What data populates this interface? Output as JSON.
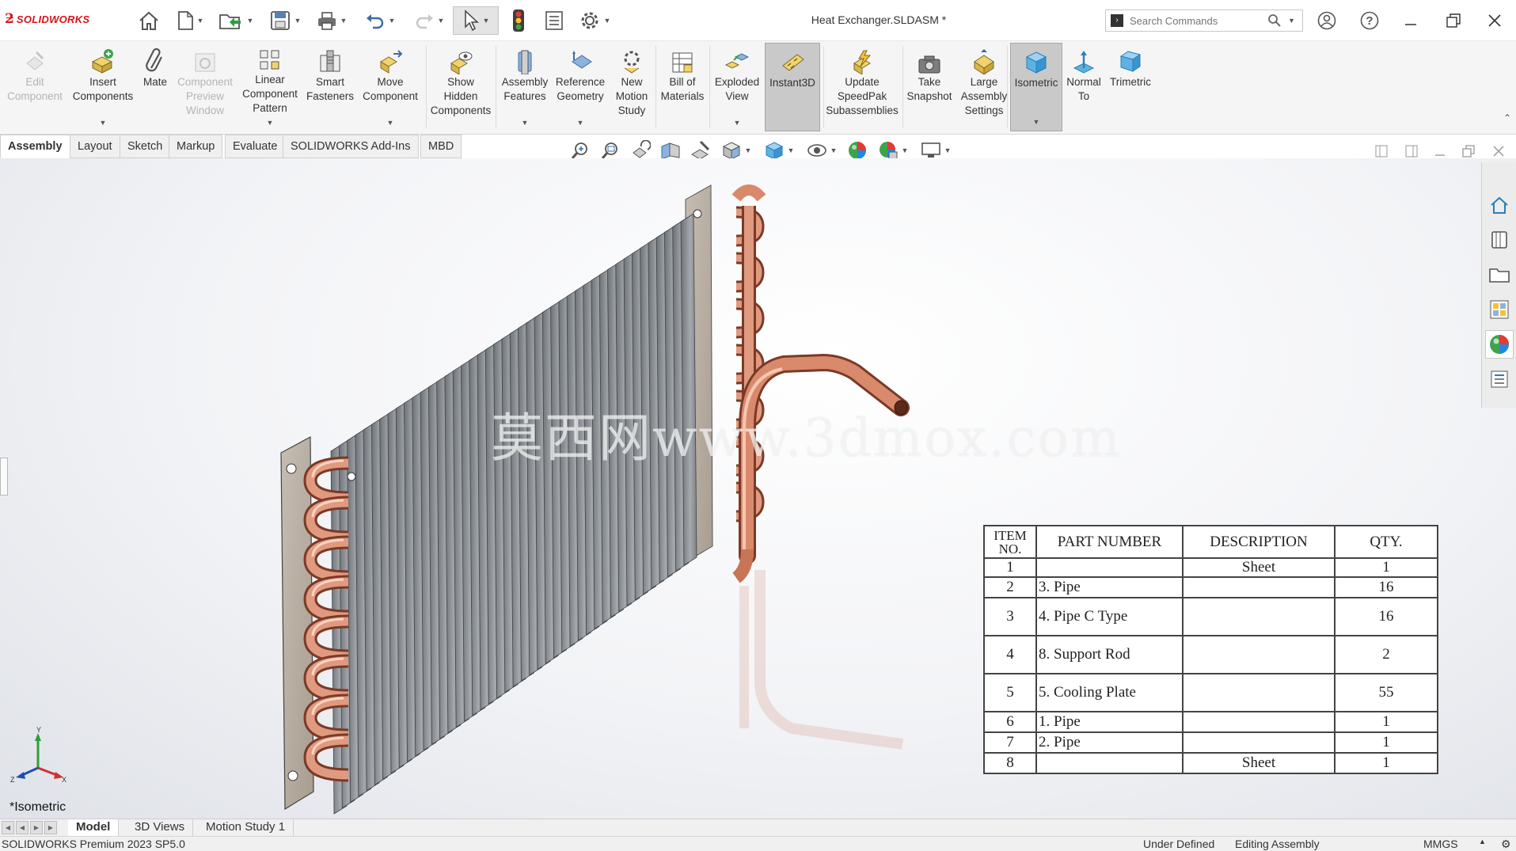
{
  "app": {
    "brand": "SOLIDWORKS",
    "document_title": "Heat Exchanger.SLDASM *"
  },
  "quick_access": [
    {
      "name": "home",
      "icon": "home-icon"
    },
    {
      "name": "new-document",
      "icon": "new-document-icon"
    },
    {
      "name": "open",
      "icon": "open-folder-icon"
    },
    {
      "name": "save",
      "icon": "save-icon"
    },
    {
      "name": "print",
      "icon": "print-icon"
    },
    {
      "name": "undo",
      "icon": "undo-icon"
    },
    {
      "name": "redo",
      "icon": "redo-icon"
    },
    {
      "name": "select",
      "icon": "cursor-icon"
    },
    {
      "name": "rebuild",
      "icon": "traffic-light-icon"
    },
    {
      "name": "file-properties",
      "icon": "file-properties-icon"
    },
    {
      "name": "options",
      "icon": "gear-icon"
    }
  ],
  "search": {
    "placeholder": "Search Commands",
    "value": ""
  },
  "ribbon": {
    "edit_component": "Edit\nComponent",
    "insert_components": "Insert\nComponents",
    "mate": "Mate",
    "component_preview": "Component\nPreview\nWindow",
    "linear_pattern": "Linear\nComponent\nPattern",
    "smart_fasteners": "Smart\nFasteners",
    "move_component": "Move\nComponent",
    "show_hidden": "Show\nHidden\nComponents",
    "assembly_features": "Assembly\nFeatures",
    "reference_geometry": "Reference\nGeometry",
    "new_motion_study": "New\nMotion\nStudy",
    "bill_of_materials": "Bill of\nMaterials",
    "exploded_view": "Exploded\nView",
    "instant3d": "Instant3D",
    "update_speedpak": "Update\nSpeedPak\nSubassemblies",
    "take_snapshot": "Take\nSnapshot",
    "large_assembly": "Large\nAssembly\nSettings",
    "isometric": "Isometric",
    "normal_to": "Normal\nTo",
    "trimetric": "Trimetric"
  },
  "command_tabs": [
    "Assembly",
    "Layout",
    "Sketch",
    "Markup",
    "Evaluate",
    "SOLIDWORKS Add-Ins",
    "MBD"
  ],
  "active_command_tab": "Assembly",
  "heads_up_toolbar": [
    "zoom-to-fit-icon",
    "zoom-to-area-icon",
    "previous-view-icon",
    "section-view-icon",
    "dynamic-annotation-icon",
    "view-orientation-icon",
    "display-style-icon",
    "hide-show-items-icon",
    "edit-appearance-icon",
    "apply-scene-icon",
    "view-settings-icon"
  ],
  "viewport": {
    "watermark": "莫西网www.3dmox.com",
    "view_name": "*Isometric",
    "triad": {
      "x": "X",
      "y": "Y",
      "z": "Z"
    }
  },
  "bom": {
    "headers": {
      "item": "ITEM NO.",
      "part": "PART NUMBER",
      "description": "DESCRIPTION",
      "qty": "QTY."
    },
    "rows": [
      {
        "item": "1",
        "part": "",
        "description": "Sheet",
        "qty": "1"
      },
      {
        "item": "2",
        "part": "3. Pipe",
        "description": "",
        "qty": "16"
      },
      {
        "item": "3",
        "part": "4. Pipe C Type",
        "description": "",
        "qty": "16"
      },
      {
        "item": "4",
        "part": "8. Support Rod",
        "description": "",
        "qty": "2"
      },
      {
        "item": "5",
        "part": "5. Cooling Plate",
        "description": "",
        "qty": "55"
      },
      {
        "item": "6",
        "part": "1. Pipe",
        "description": "",
        "qty": "1"
      },
      {
        "item": "7",
        "part": "2. Pipe",
        "description": "",
        "qty": "1"
      },
      {
        "item": "8",
        "part": "",
        "description": "Sheet",
        "qty": "1"
      }
    ]
  },
  "task_pane": [
    "home-icon",
    "design-library-icon",
    "file-explorer-icon",
    "view-palette-icon",
    "appearances-icon",
    "custom-properties-icon"
  ],
  "bottom_tabs": [
    "Model",
    "3D Views",
    "Motion Study 1"
  ],
  "active_bottom_tab": "Model",
  "status": {
    "product": "SOLIDWORKS Premium 2023 SP5.0",
    "definition": "Under Defined",
    "mode": "Editing Assembly",
    "units": "MMGS"
  },
  "colors": {
    "brand_red": "#d7141a",
    "copper": "#c87457",
    "fin_gray": "#8e9297",
    "plate": "#b8aea3"
  }
}
